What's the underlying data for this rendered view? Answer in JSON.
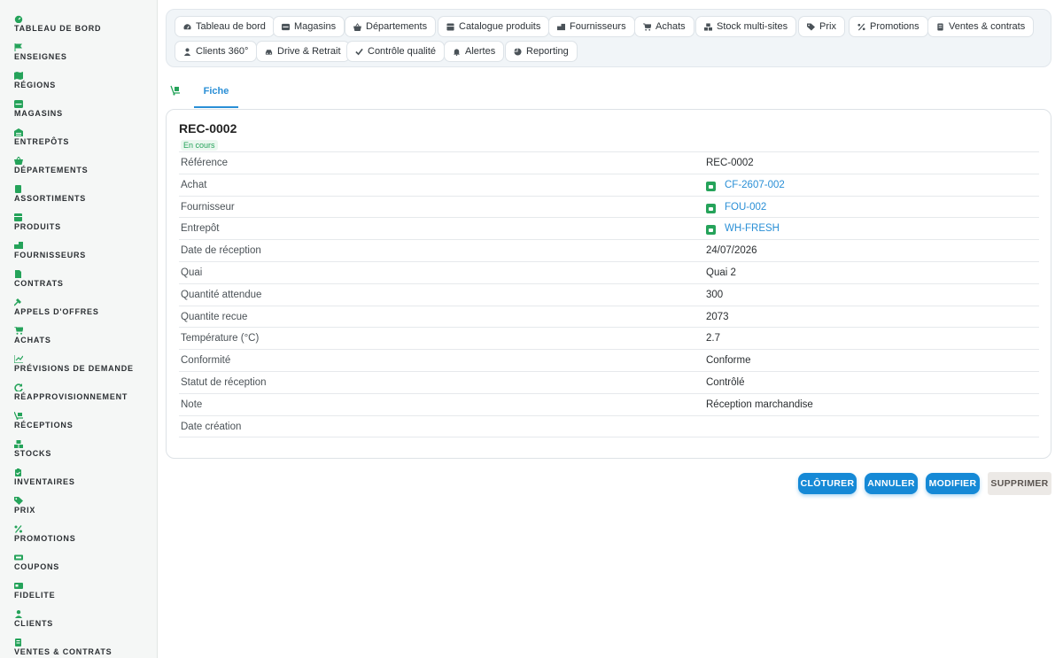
{
  "sidebar": {
    "items": [
      {
        "label": "TABLEAU DE BORD",
        "icon": "dashboard-icon"
      },
      {
        "label": "ENSEIGNES",
        "icon": "flag-icon"
      },
      {
        "label": "RÉGIONS",
        "icon": "map-icon"
      },
      {
        "label": "MAGASINS",
        "icon": "store-icon"
      },
      {
        "label": "ENTREPÔTS",
        "icon": "warehouse-icon"
      },
      {
        "label": "DÉPARTEMENTS",
        "icon": "basket-icon"
      },
      {
        "label": "ASSORTIMENTS",
        "icon": "document-icon"
      },
      {
        "label": "PRODUITS",
        "icon": "box-icon"
      },
      {
        "label": "FOURNISSEURS",
        "icon": "truck-icon"
      },
      {
        "label": "CONTRATS",
        "icon": "contract-icon"
      },
      {
        "label": "APPELS D'OFFRES",
        "icon": "gavel-icon"
      },
      {
        "label": "ACHATS",
        "icon": "cart-icon"
      },
      {
        "label": "PRÉVISIONS DE DEMANDE",
        "icon": "chart-icon"
      },
      {
        "label": "RÉAPPROVISIONNEMENT",
        "icon": "refresh-icon"
      },
      {
        "label": "RÉCEPTIONS",
        "icon": "dolly-icon"
      },
      {
        "label": "STOCKS",
        "icon": "boxes-icon"
      },
      {
        "label": "INVENTAIRES",
        "icon": "clipboard-icon"
      },
      {
        "label": "PRIX",
        "icon": "tag-icon"
      },
      {
        "label": "PROMOTIONS",
        "icon": "percent-icon"
      },
      {
        "label": "COUPONS",
        "icon": "ticket-icon"
      },
      {
        "label": "FIDELITE",
        "icon": "card-icon"
      },
      {
        "label": "CLIENTS",
        "icon": "user-icon"
      },
      {
        "label": "VENTES & CONTRATS",
        "icon": "receipt-icon"
      }
    ]
  },
  "topnav": {
    "items": [
      {
        "label": "Tableau de bord",
        "icon": "dashboard-icon"
      },
      {
        "label": "Magasins",
        "icon": "store-icon"
      },
      {
        "label": "Départements",
        "icon": "basket-icon"
      },
      {
        "label": "Catalogue produits",
        "icon": "box-icon"
      },
      {
        "label": "Fournisseurs",
        "icon": "truck-icon"
      },
      {
        "label": "Achats",
        "icon": "cart-icon"
      },
      {
        "label": "Stock multi-sites",
        "icon": "boxes-icon"
      },
      {
        "label": "Prix",
        "icon": "tag-icon"
      },
      {
        "label": "Promotions",
        "icon": "percent-icon"
      },
      {
        "label": "Ventes & contrats",
        "icon": "receipt-icon"
      },
      {
        "label": "Clients 360°",
        "icon": "user-icon"
      },
      {
        "label": "Drive & Retrait",
        "icon": "car-icon"
      },
      {
        "label": "Contrôle qualité",
        "icon": "check-icon"
      },
      {
        "label": "Alertes",
        "icon": "bell-icon"
      },
      {
        "label": "Reporting",
        "icon": "pie-icon"
      }
    ]
  },
  "tabs": {
    "fiche": "Fiche"
  },
  "record": {
    "title": "REC-0002",
    "status": "En cours",
    "fields": [
      {
        "label": "Référence",
        "value": "REC-0002",
        "link": false
      },
      {
        "label": "Achat",
        "value": "CF-2607-002",
        "link": true
      },
      {
        "label": "Fournisseur",
        "value": "FOU-002",
        "link": true
      },
      {
        "label": "Entrepôt",
        "value": "WH-FRESH",
        "link": true
      },
      {
        "label": "Date de réception",
        "value": "24/07/2026",
        "link": false
      },
      {
        "label": "Quai",
        "value": "Quai 2",
        "link": false
      },
      {
        "label": "Quantité attendue",
        "value": "300",
        "link": false
      },
      {
        "label": "Quantite recue",
        "value": "2073",
        "link": false
      },
      {
        "label": "Température (°C)",
        "value": "2.7",
        "link": false
      },
      {
        "label": "Conformité",
        "value": "Conforme",
        "link": false
      },
      {
        "label": "Statut de réception",
        "value": "Contrôlé",
        "link": false
      },
      {
        "label": "Note",
        "value": "Réception marchandise",
        "link": false
      },
      {
        "label": "Date création",
        "value": "",
        "link": false
      }
    ]
  },
  "actions": {
    "close": "CLÔTURER",
    "cancel": "ANNULER",
    "edit": "MODIFIER",
    "delete": "SUPPRIMER"
  },
  "colors": {
    "accent": "#1589d6",
    "link": "#2a8fd6",
    "success": "#25a35a"
  }
}
